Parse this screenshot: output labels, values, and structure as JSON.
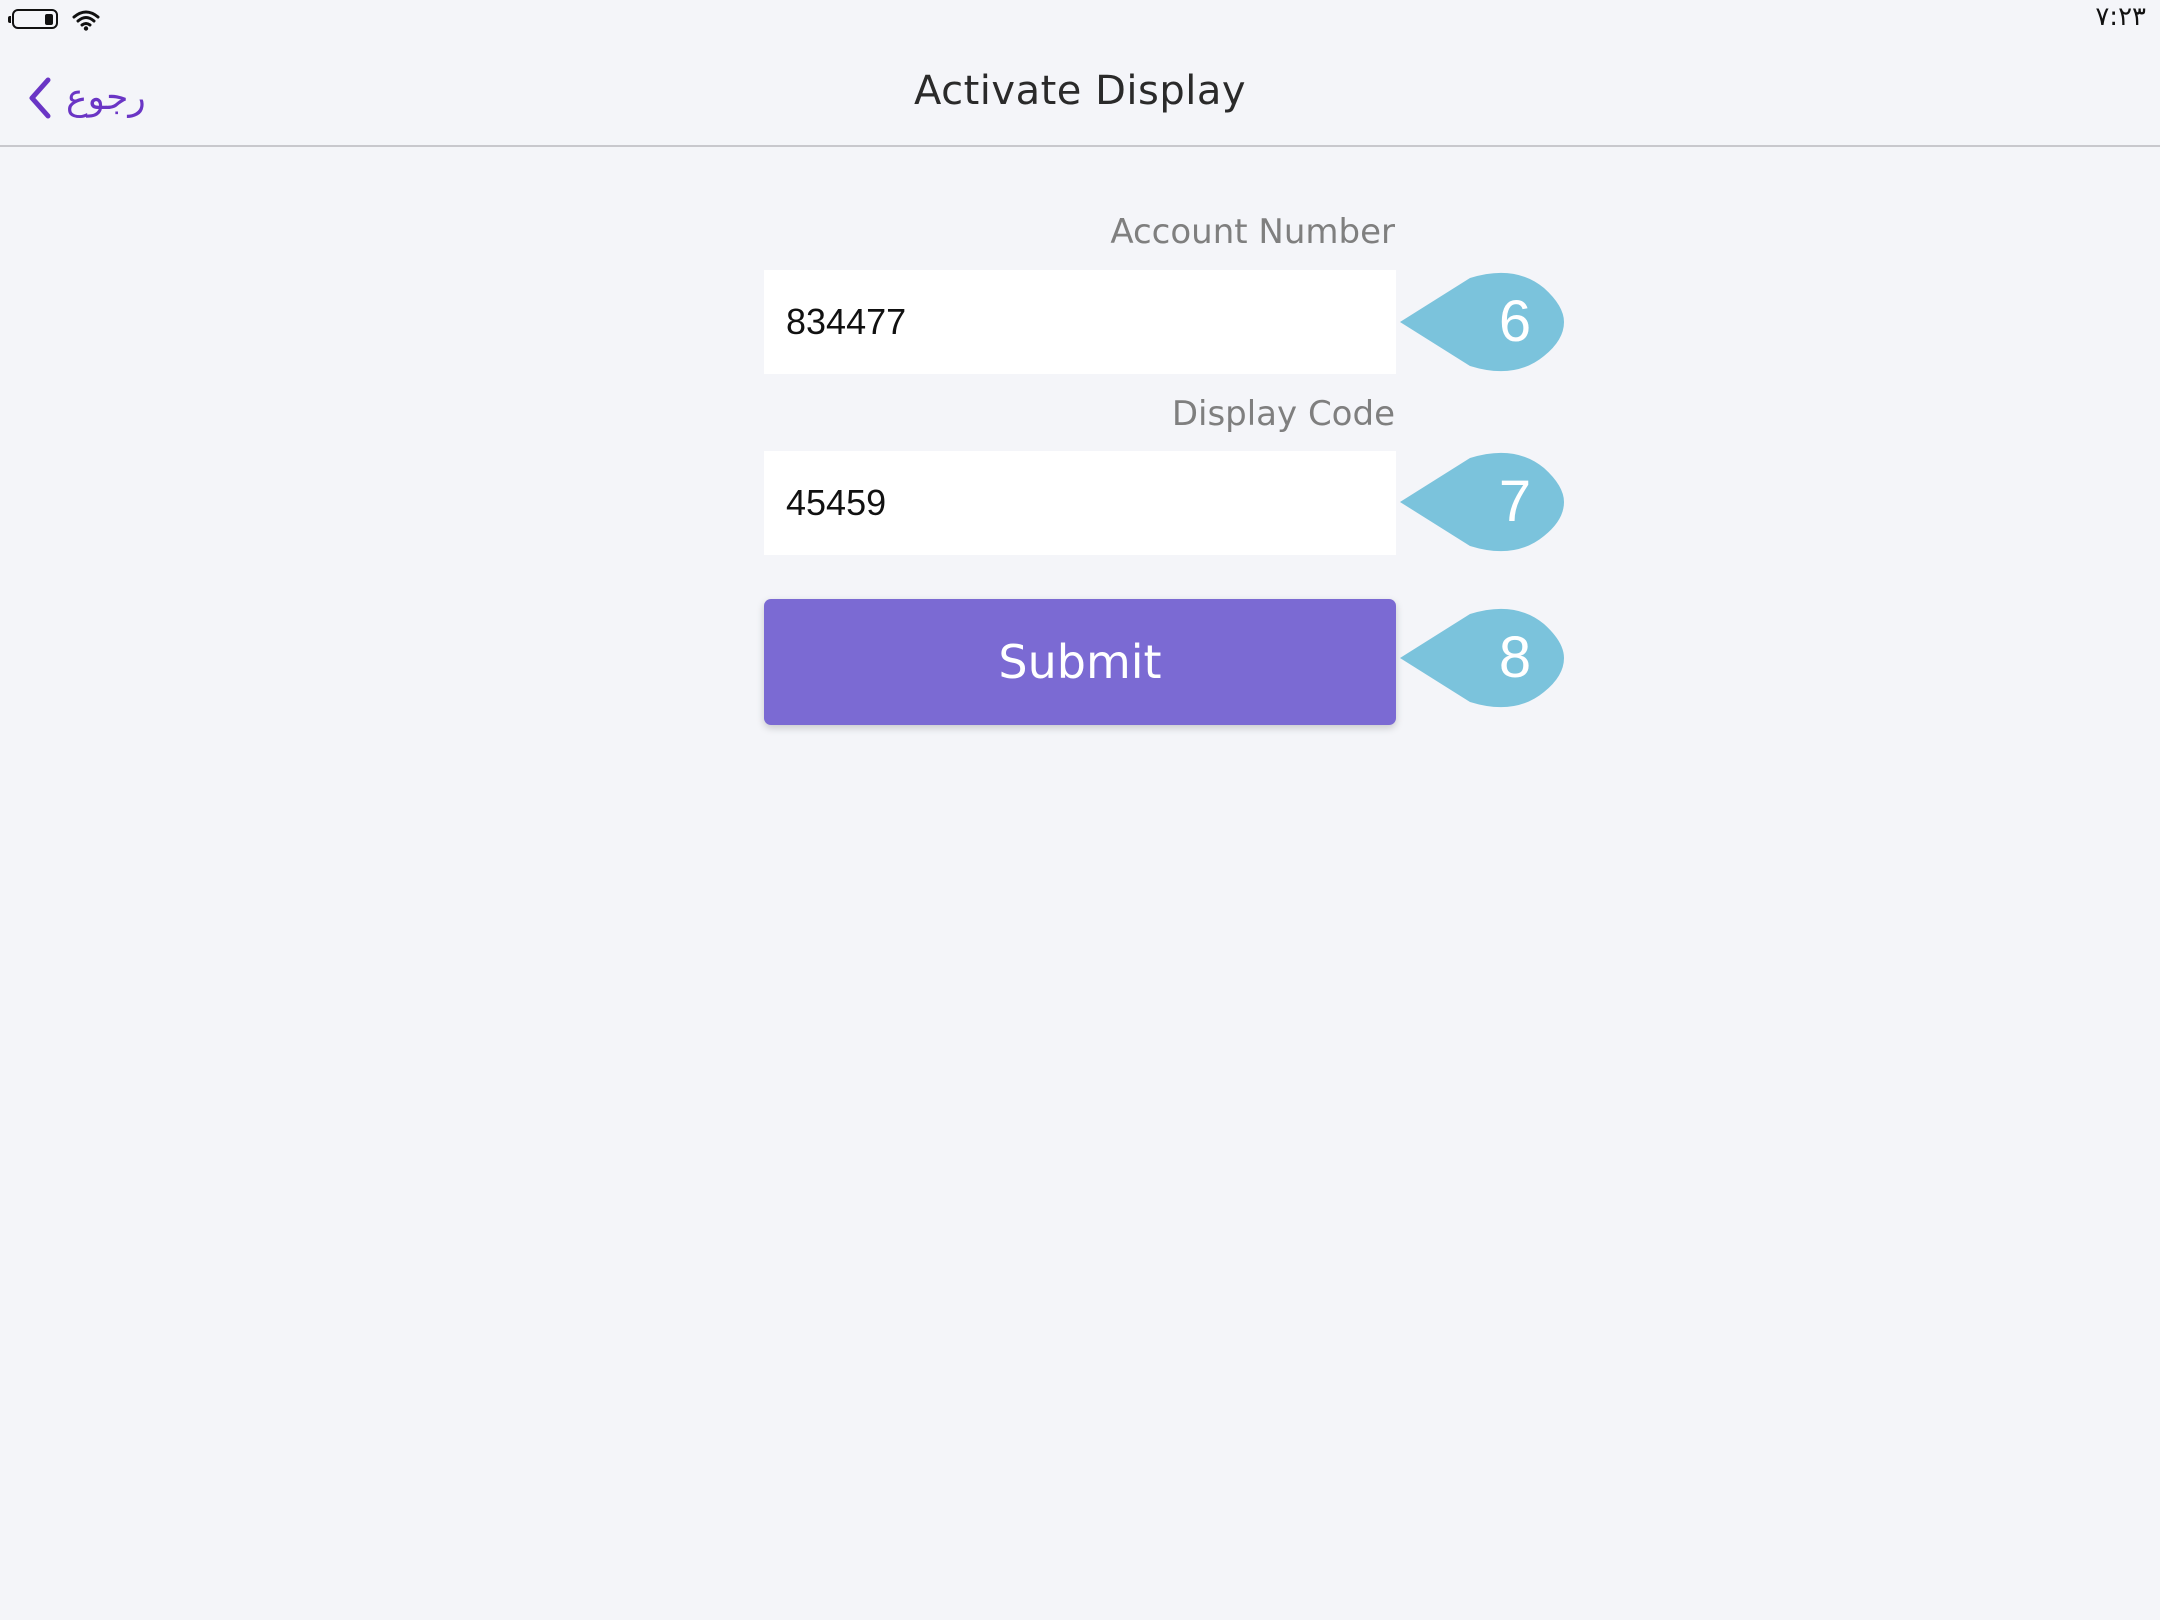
{
  "status_bar": {
    "time": "٧:٢٣",
    "battery_icon": "battery-icon",
    "wifi_icon": "wifi-icon"
  },
  "nav": {
    "back_label": "رجوع",
    "back_icon": "chevron-left-icon",
    "title": "Activate Display"
  },
  "form": {
    "account_number_label": "Account Number",
    "account_number_value": "834477",
    "display_code_label": "Display Code",
    "display_code_value": "45459",
    "submit_label": "Submit"
  },
  "callouts": {
    "account_marker": "6",
    "display_code_marker": "7",
    "submit_marker": "8",
    "color": "#7bc3dc"
  },
  "colors": {
    "accent": "#6a35c5",
    "button": "#7b6ad3",
    "background": "#f4f5f9"
  }
}
